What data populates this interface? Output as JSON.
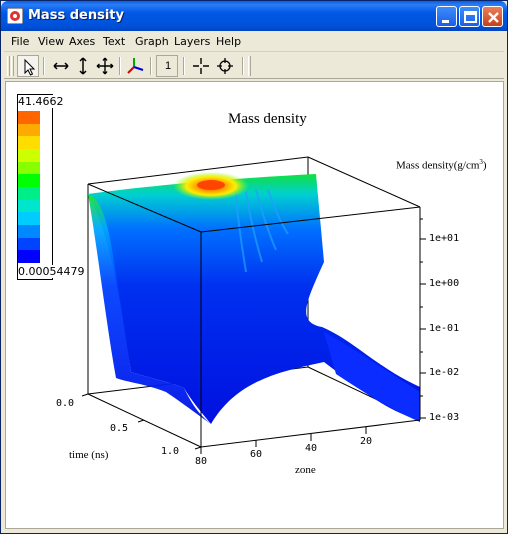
{
  "window": {
    "title": "Mass density",
    "icon": "app-icon"
  },
  "menubar": {
    "items": [
      {
        "label": "File"
      },
      {
        "label": "View"
      },
      {
        "label": "Axes"
      },
      {
        "label": "Text"
      },
      {
        "label": "Graph"
      },
      {
        "label": "Layers"
      },
      {
        "label": "Help"
      }
    ]
  },
  "toolbar": {
    "buttons": [
      {
        "icon": "pointer-icon",
        "pressed": true
      },
      {
        "icon": "horizontal-arrows-icon"
      },
      {
        "icon": "vertical-arrows-icon"
      },
      {
        "icon": "four-way-arrows-icon"
      },
      {
        "icon": "axes-3d-icon"
      },
      {
        "icon": "one-button",
        "label": "1"
      },
      {
        "icon": "crosshair-icon"
      },
      {
        "icon": "target-icon"
      }
    ]
  },
  "legend": {
    "max_label": "41.4662",
    "min_label": "0.00054479",
    "colors": [
      "#ff6600",
      "#ffaa00",
      "#ffdd00",
      "#ccff00",
      "#88ff00",
      "#00ff00",
      "#00ee88",
      "#00e6cc",
      "#00ccff",
      "#0088ff",
      "#0044ff",
      "#0000ff"
    ]
  },
  "plot": {
    "title": "Mass density",
    "z_axis_label": "Mass density(g/cm",
    "z_axis_label_sup": "3",
    "z_axis_label_close": ")",
    "z_ticks": [
      "1e+01",
      "1e+00",
      "1e-01",
      "1e-02",
      "1e-03"
    ],
    "time_label": "time (ns)",
    "time_ticks": [
      "0.0",
      "0.5",
      "1.0"
    ],
    "zone_label": "zone",
    "zone_ticks": [
      "80",
      "60",
      "40",
      "20"
    ]
  }
}
